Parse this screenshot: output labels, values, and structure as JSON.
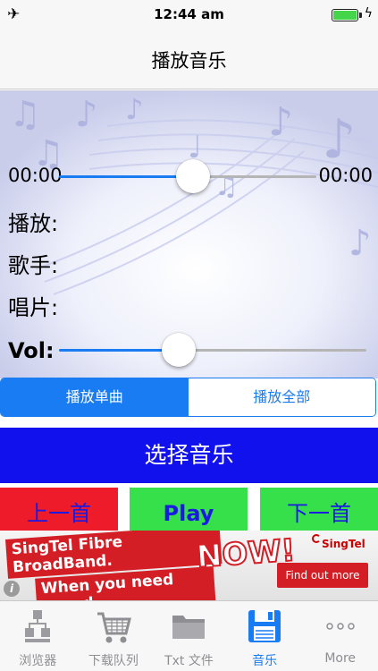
{
  "status_bar": {
    "time": "12:44 am",
    "airplane_icon": "airplane-icon",
    "battery_icon": "battery-icon",
    "charging_icon": "charging-bolt-icon"
  },
  "nav": {
    "title": "播放音乐"
  },
  "player": {
    "time_elapsed": "00:00",
    "time_total": "00:00",
    "progress_fraction": 0.52,
    "labels": {
      "playing": "播放:",
      "artist": "歌手:",
      "album": "唱片:",
      "volume": "Vol:"
    },
    "volume_fraction": 0.39
  },
  "mode_segment": {
    "options": [
      "播放单曲",
      "播放全部"
    ],
    "selected_index": 0
  },
  "select_music_label": "选择音乐",
  "controls": {
    "prev_label": "上一首",
    "play_label": "Play",
    "next_label": "下一首"
  },
  "ad": {
    "line1": "SingTel Fibre BroadBand.",
    "line2": "When you need speed",
    "now": "NOW!",
    "brand": "SingTel",
    "cta": "Find out more",
    "info": "i"
  },
  "tabs": [
    {
      "label": "浏览器",
      "icon": "browser-sitemap-icon"
    },
    {
      "label": "下载队列",
      "icon": "shopping-cart-icon"
    },
    {
      "label": "Txt 文件",
      "icon": "folder-icon"
    },
    {
      "label": "音乐",
      "icon": "floppy-disk-icon",
      "active": true
    },
    {
      "label": "More",
      "icon": "more-dots-icon"
    }
  ],
  "colors": {
    "accent_blue": "#1a7cf3",
    "select_button": "#1111ee",
    "prev_button": "#ee1c2a",
    "play_next_button": "#35e04a",
    "control_text": "#1a1ae0"
  }
}
